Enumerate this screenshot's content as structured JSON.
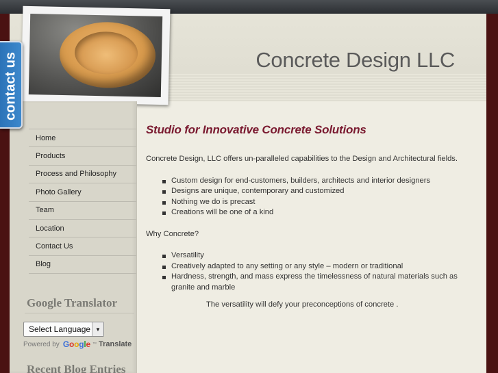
{
  "header": {
    "site_title": "Concrete Design LLC"
  },
  "contact_tab": {
    "label": "contact us"
  },
  "nav": {
    "items": [
      {
        "label": "Home"
      },
      {
        "label": "Products"
      },
      {
        "label": "Process and Philosophy"
      },
      {
        "label": "Photo Gallery"
      },
      {
        "label": "Team"
      },
      {
        "label": "Location"
      },
      {
        "label": "Contact Us"
      },
      {
        "label": "Blog"
      }
    ]
  },
  "translator": {
    "title": "Google Translator",
    "select_value": "Select Language",
    "powered_by": "Powered by",
    "google": "Google",
    "tm": "™",
    "translate": "Translate"
  },
  "blog": {
    "title": "Recent Blog Entries"
  },
  "content": {
    "heading": "Studio for Innovative  Concrete Solutions",
    "intro": "Concrete Design, LLC offers un-paralleled capabilities to the Design and Architectural fields.",
    "list1": [
      "Custom design for end-customers, builders, architects and interior designers",
      "Designs are unique, contemporary and customized",
      "Nothing we do is precast",
      "Creations will be one of a kind"
    ],
    "why": "Why Concrete?",
    "list2": [
      "Versatility",
      "Creatively adapted to any setting or any style – modern or traditional",
      "Hardness, strength, and mass express the timelessness of natural materials such as granite and marble"
    ],
    "closing": "The versatility will defy your preconceptions of concrete ."
  },
  "colors": {
    "heading": "#7a1a30",
    "contact_tab": "#2c73b8",
    "google_blue": "#3b6fd8",
    "google_red": "#d93a2b",
    "google_yellow": "#e8a400",
    "google_green": "#2f9c3e"
  },
  "icons": {
    "select_arrow": "triangle-down-icon"
  }
}
